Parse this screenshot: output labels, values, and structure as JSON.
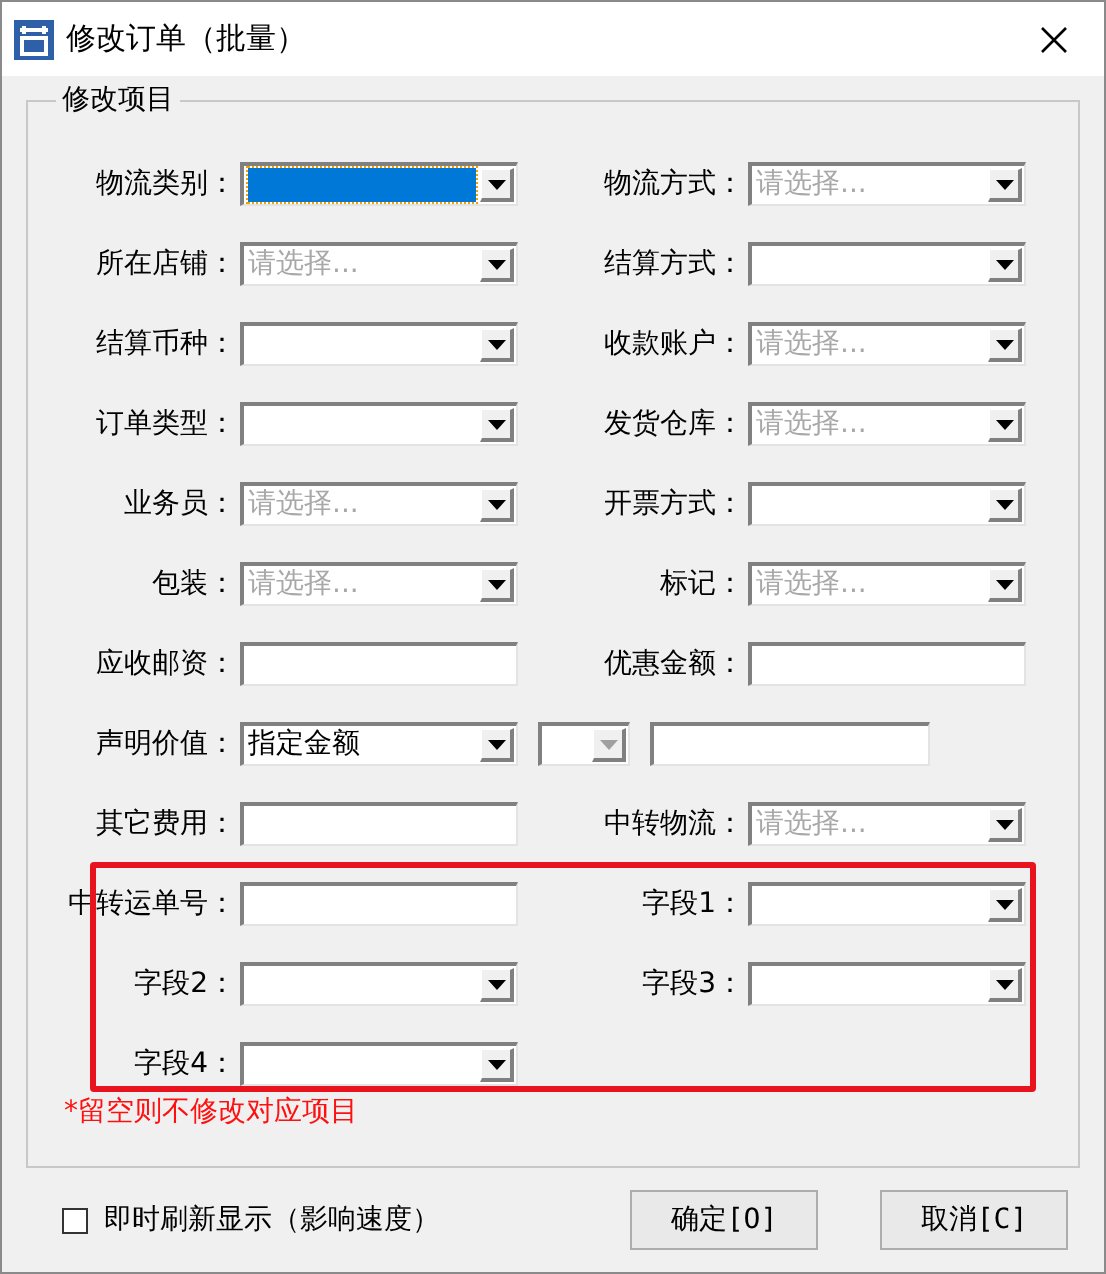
{
  "window": {
    "title": "修改订单（批量）"
  },
  "group": {
    "title": "修改项目"
  },
  "rows": [
    {
      "left": {
        "label": "物流类别：",
        "field": {
          "kind": "combo",
          "selected": true
        }
      },
      "right": {
        "label": "物流方式：",
        "field": {
          "kind": "combo",
          "placeholder": "请选择..."
        }
      }
    },
    {
      "left": {
        "label": "所在店铺：",
        "field": {
          "kind": "combo",
          "placeholder": "请选择..."
        }
      },
      "right": {
        "label": "结算方式：",
        "field": {
          "kind": "combo"
        }
      }
    },
    {
      "left": {
        "label": "结算币种：",
        "field": {
          "kind": "combo"
        }
      },
      "right": {
        "label": "收款账户：",
        "field": {
          "kind": "combo",
          "placeholder": "请选择..."
        }
      }
    },
    {
      "left": {
        "label": "订单类型：",
        "field": {
          "kind": "combo"
        }
      },
      "right": {
        "label": "发货仓库：",
        "field": {
          "kind": "combo",
          "placeholder": "请选择..."
        }
      }
    },
    {
      "left": {
        "label": "业务员：",
        "field": {
          "kind": "combo",
          "placeholder": "请选择..."
        }
      },
      "right": {
        "label": "开票方式：",
        "field": {
          "kind": "combo"
        }
      }
    },
    {
      "left": {
        "label": "包装：",
        "field": {
          "kind": "combo",
          "placeholder": "请选择..."
        }
      },
      "right": {
        "label": "标记：",
        "field": {
          "kind": "combo",
          "placeholder": "请选择..."
        }
      }
    },
    {
      "left": {
        "label": "应收邮资：",
        "field": {
          "kind": "text"
        }
      },
      "right": {
        "label": "优惠金额：",
        "field": {
          "kind": "text"
        }
      }
    },
    {
      "left": {
        "label": "声明价值：",
        "field": {
          "kind": "combo",
          "value": "指定金额"
        }
      },
      "extras": [
        {
          "kind": "combo",
          "disabled": true
        },
        {
          "kind": "text"
        }
      ]
    },
    {
      "left": {
        "label": "其它费用：",
        "field": {
          "kind": "text"
        }
      },
      "right": {
        "label": "中转物流：",
        "field": {
          "kind": "combo",
          "placeholder": "请选择..."
        }
      }
    },
    {
      "left": {
        "label": "中转运单号：",
        "field": {
          "kind": "text"
        }
      },
      "right": {
        "label": "字段1：",
        "field": {
          "kind": "combo"
        }
      }
    },
    {
      "left": {
        "label": "字段2：",
        "field": {
          "kind": "combo"
        }
      },
      "right": {
        "label": "字段3：",
        "field": {
          "kind": "combo"
        }
      }
    },
    {
      "left": {
        "label": "字段4：",
        "field": {
          "kind": "combo"
        }
      }
    }
  ],
  "note": "*留空则不修改对应项目",
  "refresh": {
    "label": "即时刷新显示（影响速度）",
    "checked": false
  },
  "buttons": [
    "确定[O]",
    "取消[C]"
  ]
}
